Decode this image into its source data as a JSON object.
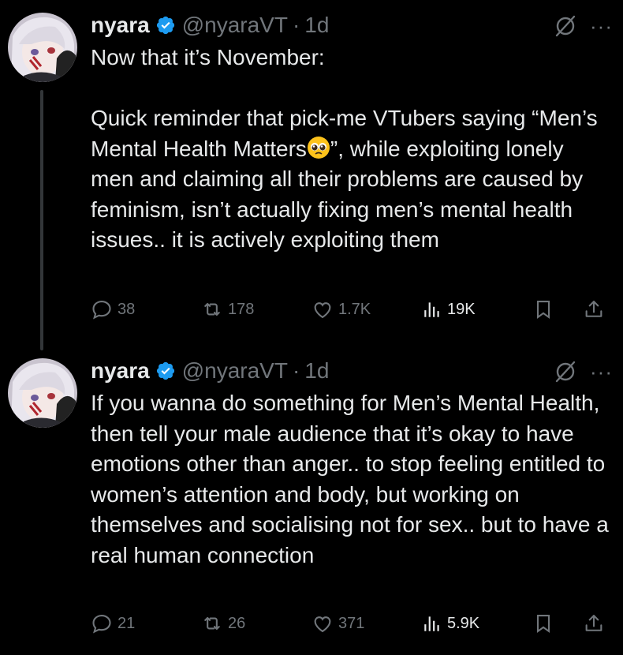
{
  "tweets": [
    {
      "name": "nyara",
      "handle": "@nyaraVT",
      "dot": "·",
      "time": "1d",
      "more": "···",
      "body_before_emoji": "Now that it’s November:\n\nQuick reminder that pick-me VTubers saying “Men’s Mental Health Matters",
      "emoji": "pleading-face-emoji",
      "body_after_emoji": "”, while exploiting lonely men and claiming all their problems are caused by feminism, isn’t actually fixing men’s mental health issues.. it is actively exploiting them",
      "stats": {
        "replies": "38",
        "reposts": "178",
        "likes": "1.7K",
        "views": "19K"
      }
    },
    {
      "name": "nyara",
      "handle": "@nyaraVT",
      "dot": "·",
      "time": "1d",
      "more": "···",
      "body": "If you wanna do something for Men’s Mental Health, then tell your male audience that it’s okay to have emotions other than anger.. to stop feeling entitled to women’s attention and body, but working on themselves and socialising not for sex.. but to have a real human connection",
      "stats": {
        "replies": "21",
        "reposts": "26",
        "likes": "371",
        "views": "5.9K"
      }
    }
  ],
  "icons": {
    "verified": "verified-badge-icon",
    "grok": "grok-icon",
    "reply": "reply-icon",
    "repost": "repost-icon",
    "like": "like-icon",
    "views": "views-icon",
    "bookmark": "bookmark-icon",
    "share": "share-icon"
  },
  "colors": {
    "background": "#000000",
    "text": "#e7e9ea",
    "muted": "#71767b",
    "verified": "#1d9bf0"
  }
}
